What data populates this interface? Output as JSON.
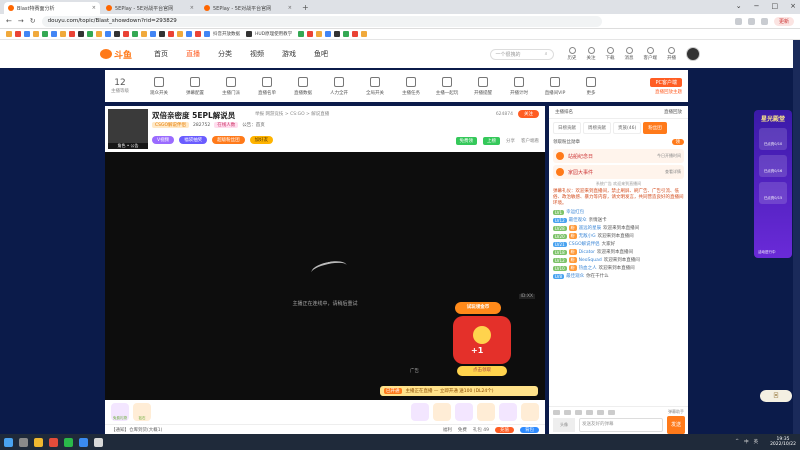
{
  "browser": {
    "tabs": [
      {
        "title": "Blast特赛面分析",
        "active": true
      },
      {
        "title": "5EPlay - 5E对战平台官网",
        "active": false
      },
      {
        "title": "5EPlay - 5E对战平台官网",
        "active": false
      }
    ],
    "url": "douyu.com/topic/Blast_showdown?rid=293829",
    "update_label": "更新",
    "bookmarks": [
      "抖音",
      "",
      "",
      "",
      "",
      "",
      "",
      "",
      "",
      "抖音开放数据",
      "HUD原理使用教学",
      "",
      "",
      "",
      "",
      "",
      "",
      ""
    ]
  },
  "site_header": {
    "logo_text": "斗鱼",
    "nav": [
      "首页",
      "直播",
      "分类",
      "视频",
      "游戏",
      "鱼吧"
    ],
    "active_nav": "直播",
    "search_placeholder": "一个很拽的",
    "icons": [
      {
        "label": "历史",
        "icon": "clock-icon"
      },
      {
        "label": "关注",
        "icon": "heart-icon"
      },
      {
        "label": "下载",
        "icon": "download-icon"
      },
      {
        "label": "消息",
        "icon": "bell-icon"
      },
      {
        "label": "客户端",
        "icon": "client-icon"
      },
      {
        "label": "开播",
        "icon": "broadcast-icon"
      }
    ]
  },
  "toolbar": {
    "level": "12",
    "level_label": "主播等级",
    "items": [
      "观众开关",
      "弹幕配置",
      "主播门派",
      "直播名单",
      "直播数据",
      "人力全开",
      "全局开关",
      "主播任务",
      "主播一起玩",
      "开播提醒",
      "开播计时",
      "直播间VIP",
      "更多"
    ],
    "pc_button": "PC客户端",
    "pc_sub": "直播回放主题"
  },
  "room": {
    "title": "双倍亲密度 5EPL解说员",
    "tag": "举报",
    "breadcrumb": "网游竞技 > CS:GO > 解说直播",
    "badge1": "CSGO解说伴侣",
    "count": "282752",
    "badge2": "在线人数",
    "info2": "公告：首页",
    "pills": [
      "V视频",
      "福袋抽奖",
      "超级粉丝团",
      "加好友"
    ],
    "room_id": "624874",
    "follow_label": "关注",
    "free_gift": "免费领",
    "ranking": "上榜",
    "share": "分享",
    "report": "客户端看",
    "streamer_label": "角色 • 公告"
  },
  "video": {
    "loading_text": "主播正在连线中，请稍后重试",
    "ad_label": "ID:XX",
    "ad_title": "试玩领金币",
    "ad_button": "点击领取",
    "ad_text": "广告",
    "bottom_tag": "已开通",
    "bottom_text": "主播正在直播 — 立即开通 送100 (DL24个)"
  },
  "gift_bar": {
    "gifts": [
      "免费礼物",
      "钻石",
      "",
      "",
      "",
      "",
      "",
      ""
    ],
    "notice": "【通知】仓库到货(大概1)",
    "items_right": [
      "福利",
      "免费",
      "礼包 49",
      "充值",
      "背包"
    ]
  },
  "chat": {
    "top_left": "主播排名",
    "top_right": "直播回放",
    "tabs": [
      "日榜贡献",
      "周榜贡献",
      "贵族(46)",
      "粉丝团"
    ],
    "active_tab": "粉丝团",
    "info": "领取粉丝勋章",
    "info_btn": "领",
    "notices": [
      {
        "title": "站船纪念日",
        "sub": "今日开播时间"
      },
      {
        "title": "家园大事件",
        "sub": "查看详情"
      }
    ],
    "system": "系统广告 欢迎来到直播间",
    "long_msg": "弹幕礼仪：欢迎来到直播间，禁止刷屏、刷广告、广告引流、低俗、政治敏感、暴力等内容，请文明发言，共同营造良好的直播间环境。",
    "messages": [
      {
        "lv": "LV1",
        "fan": "",
        "name": "幸运红包",
        "text": ""
      },
      {
        "lv": "LV12",
        "fan": "",
        "name": "最佳观众",
        "text": "亲情送卡"
      },
      {
        "lv": "LV28",
        "fan": "",
        "name": "遥远的星辰",
        "text": "欢迎来到本直播间"
      },
      {
        "lv": "LV20",
        "fan": "",
        "name": "无敌小G",
        "text": "欢迎来到本直播间"
      },
      {
        "lv": "LV21",
        "fan": "",
        "name": "CSGO解说伴侣",
        "text": "大家好"
      },
      {
        "lv": "LV18",
        "fan": "",
        "name": "Dicator",
        "text": "欢迎来到本直播间"
      },
      {
        "lv": "LV12",
        "fan": "",
        "name": "NeoSquad",
        "text": "欢迎来到本直播间"
      },
      {
        "lv": "LV10",
        "fan": "",
        "name": "热血之人",
        "text": "欢迎来到本直播间"
      },
      {
        "lv": "LV8",
        "fan": "",
        "name": "最佳观众",
        "text": "你在干什么"
      }
    ],
    "checkbox_label": "弹幕助手",
    "input_placeholder": "发送友好的弹幕",
    "send_label": "发送",
    "avatar_label": "头像"
  },
  "side_event": {
    "title": "星光殿堂",
    "rows": [
      "已点亮0/10",
      "已点亮0/16",
      "已点亮0/15"
    ],
    "footer": "活动进行中"
  },
  "back_label": "回",
  "taskbar": {
    "time": "19:35",
    "date": "2022/10/22",
    "tray": [
      "^",
      "中",
      "英"
    ]
  }
}
